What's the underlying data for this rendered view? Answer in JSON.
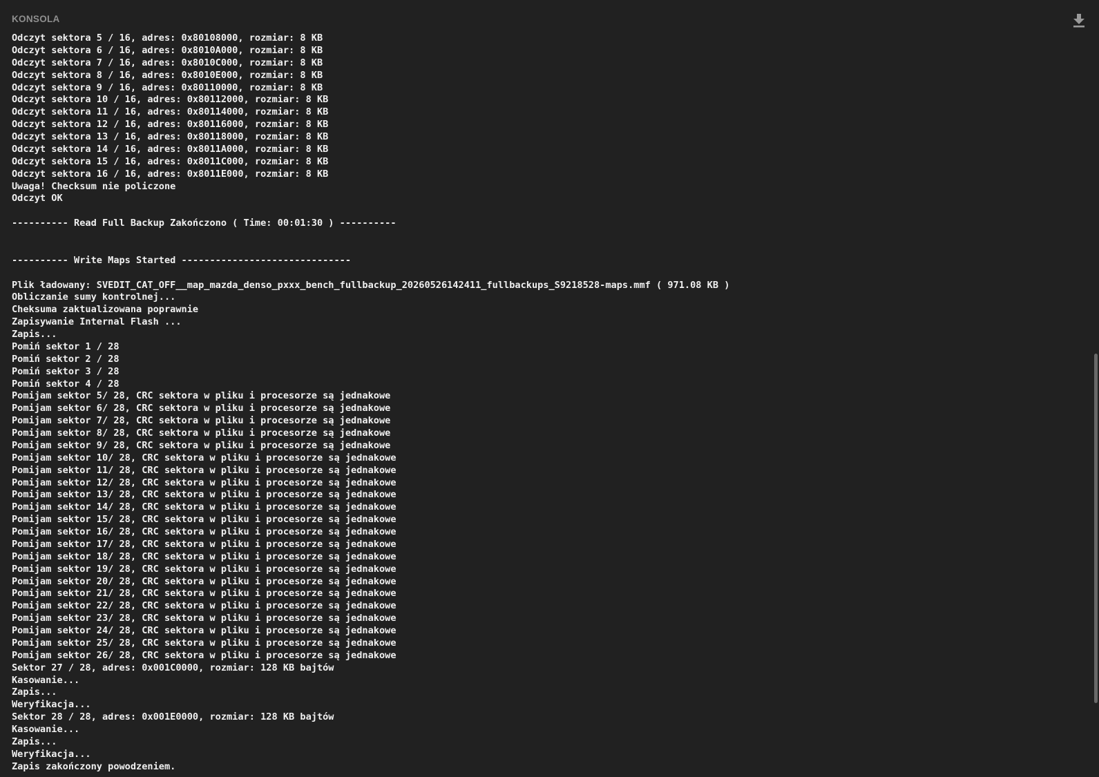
{
  "panel": {
    "title": "KONSOLA",
    "download_icon": "download-icon"
  },
  "colors": {
    "background": "#212121",
    "text": "#f0f0f0",
    "title": "#8f8f8f",
    "icon": "#9a9a9a",
    "scrollbar_thumb": "#686868"
  },
  "console": {
    "lines": [
      "Odczyt sektora 5 / 16, adres: 0x80108000, rozmiar: 8 KB",
      "Odczyt sektora 6 / 16, adres: 0x8010A000, rozmiar: 8 KB",
      "Odczyt sektora 7 / 16, adres: 0x8010C000, rozmiar: 8 KB",
      "Odczyt sektora 8 / 16, adres: 0x8010E000, rozmiar: 8 KB",
      "Odczyt sektora 9 / 16, adres: 0x80110000, rozmiar: 8 KB",
      "Odczyt sektora 10 / 16, adres: 0x80112000, rozmiar: 8 KB",
      "Odczyt sektora 11 / 16, adres: 0x80114000, rozmiar: 8 KB",
      "Odczyt sektora 12 / 16, adres: 0x80116000, rozmiar: 8 KB",
      "Odczyt sektora 13 / 16, adres: 0x80118000, rozmiar: 8 KB",
      "Odczyt sektora 14 / 16, adres: 0x8011A000, rozmiar: 8 KB",
      "Odczyt sektora 15 / 16, adres: 0x8011C000, rozmiar: 8 KB",
      "Odczyt sektora 16 / 16, adres: 0x8011E000, rozmiar: 8 KB",
      "Uwaga! Checksum nie policzone",
      "Odczyt OK",
      "",
      "---------- Read Full Backup Zakończono ( Time: 00:01:30 ) ----------",
      "",
      "",
      "---------- Write Maps Started ------------------------------",
      "",
      "Plik ładowany: SVEDIT_CAT_OFF__map_mazda_denso_pxxx_bench_fullbackup_20260526142411_fullbackups_S9218528-maps.mmf ( 971.08 KB )",
      "Obliczanie sumy kontrolnej...",
      "Cheksuma zaktualizowana poprawnie",
      "Zapisywanie Internal Flash ...",
      "Zapis...",
      "Pomiń sektor 1 / 28",
      "Pomiń sektor 2 / 28",
      "Pomiń sektor 3 / 28",
      "Pomiń sektor 4 / 28",
      "Pomijam sektor 5/ 28, CRC sektora w pliku i procesorze są jednakowe",
      "Pomijam sektor 6/ 28, CRC sektora w pliku i procesorze są jednakowe",
      "Pomijam sektor 7/ 28, CRC sektora w pliku i procesorze są jednakowe",
      "Pomijam sektor 8/ 28, CRC sektora w pliku i procesorze są jednakowe",
      "Pomijam sektor 9/ 28, CRC sektora w pliku i procesorze są jednakowe",
      "Pomijam sektor 10/ 28, CRC sektora w pliku i procesorze są jednakowe",
      "Pomijam sektor 11/ 28, CRC sektora w pliku i procesorze są jednakowe",
      "Pomijam sektor 12/ 28, CRC sektora w pliku i procesorze są jednakowe",
      "Pomijam sektor 13/ 28, CRC sektora w pliku i procesorze są jednakowe",
      "Pomijam sektor 14/ 28, CRC sektora w pliku i procesorze są jednakowe",
      "Pomijam sektor 15/ 28, CRC sektora w pliku i procesorze są jednakowe",
      "Pomijam sektor 16/ 28, CRC sektora w pliku i procesorze są jednakowe",
      "Pomijam sektor 17/ 28, CRC sektora w pliku i procesorze są jednakowe",
      "Pomijam sektor 18/ 28, CRC sektora w pliku i procesorze są jednakowe",
      "Pomijam sektor 19/ 28, CRC sektora w pliku i procesorze są jednakowe",
      "Pomijam sektor 20/ 28, CRC sektora w pliku i procesorze są jednakowe",
      "Pomijam sektor 21/ 28, CRC sektora w pliku i procesorze są jednakowe",
      "Pomijam sektor 22/ 28, CRC sektora w pliku i procesorze są jednakowe",
      "Pomijam sektor 23/ 28, CRC sektora w pliku i procesorze są jednakowe",
      "Pomijam sektor 24/ 28, CRC sektora w pliku i procesorze są jednakowe",
      "Pomijam sektor 25/ 28, CRC sektora w pliku i procesorze są jednakowe",
      "Pomijam sektor 26/ 28, CRC sektora w pliku i procesorze są jednakowe",
      "Sektor 27 / 28, adres: 0x001C0000, rozmiar: 128 KB bajtów",
      "Kasowanie...",
      "Zapis...",
      "Weryfikacja...",
      "Sektor 28 / 28, adres: 0x001E0000, rozmiar: 128 KB bajtów",
      "Kasowanie...",
      "Zapis...",
      "Weryfikacja...",
      "Zapis zakończony powodzeniem."
    ]
  },
  "scrollbar": {
    "thumb_start_fraction": 0.43,
    "thumb_size_fraction": 0.47
  }
}
